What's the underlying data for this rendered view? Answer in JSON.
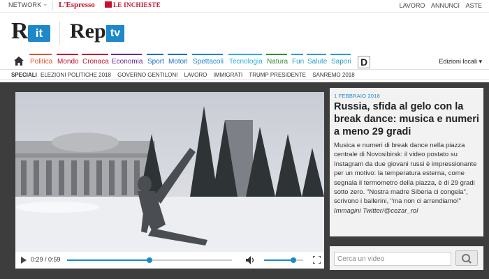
{
  "topbar": {
    "network": "NETWORK",
    "espresso": "L'Espresso",
    "inchieste": "LE INCHIESTE",
    "links": [
      "LAVORO",
      "ANNUNCI",
      "ASTE"
    ]
  },
  "logos": {
    "rit_r": "R",
    "rit_it": "it",
    "rep": "Rep",
    "tv": "tv"
  },
  "nav": {
    "items": [
      {
        "label": "Politica",
        "color": "#e0552c"
      },
      {
        "label": "Mondo",
        "color": "#c8102e"
      },
      {
        "label": "Cronaca",
        "color": "#c8102e"
      },
      {
        "label": "Economia",
        "color": "#6a2c8c"
      },
      {
        "label": "Sport",
        "color": "#1e6cc8"
      },
      {
        "label": "Motori",
        "color": "#1e6cc8"
      },
      {
        "label": "Spettacoli",
        "color": "#1e88c8"
      },
      {
        "label": "Tecnologia",
        "color": "#2ab0d8"
      },
      {
        "label": "Natura",
        "color": "#3a8c3a"
      },
      {
        "label": "Fun",
        "color": "#2aa0c8"
      },
      {
        "label": "Salute",
        "color": "#2aa0c8"
      },
      {
        "label": "Sapori",
        "color": "#2aa0c8"
      }
    ],
    "d_label": "D",
    "edizioni": "Edizioni locali"
  },
  "specials": {
    "label": "SPECIALI",
    "items": [
      "ELEZIONI POLITICHE 2018",
      "GOVERNO GENTILONI",
      "LAVORO",
      "IMMIGRATI",
      "TRUMP PRESIDENTE",
      "SANREMO 2018"
    ]
  },
  "video": {
    "time": "0:29 / 0:59",
    "progress": 0.5,
    "volume": 0.75
  },
  "article": {
    "date": "1 FEBBRAIO 2018",
    "title": "Russia, sfida al gelo con la break dance: musica e numeri a meno 29 gradi",
    "description": "Musica e numeri di break dance nella piazza centrale di Novosibirsk: il video postato su Instagram da due giovani russi è impressionante per un motivo: la temperatura esterna, come segnala il termometro della piazza, è di 29 gradi sotto zero. \"Nostra madre Siberia ci congela\", scrivono i ballerini, \"ma non ci arrendiamo!\"",
    "credit": "Immagini Twitter/@cezar_rol"
  },
  "search": {
    "placeholder": "Cerca un video"
  },
  "colors": {
    "accent": "#1e88c8",
    "stage": "#3d3d3d"
  }
}
